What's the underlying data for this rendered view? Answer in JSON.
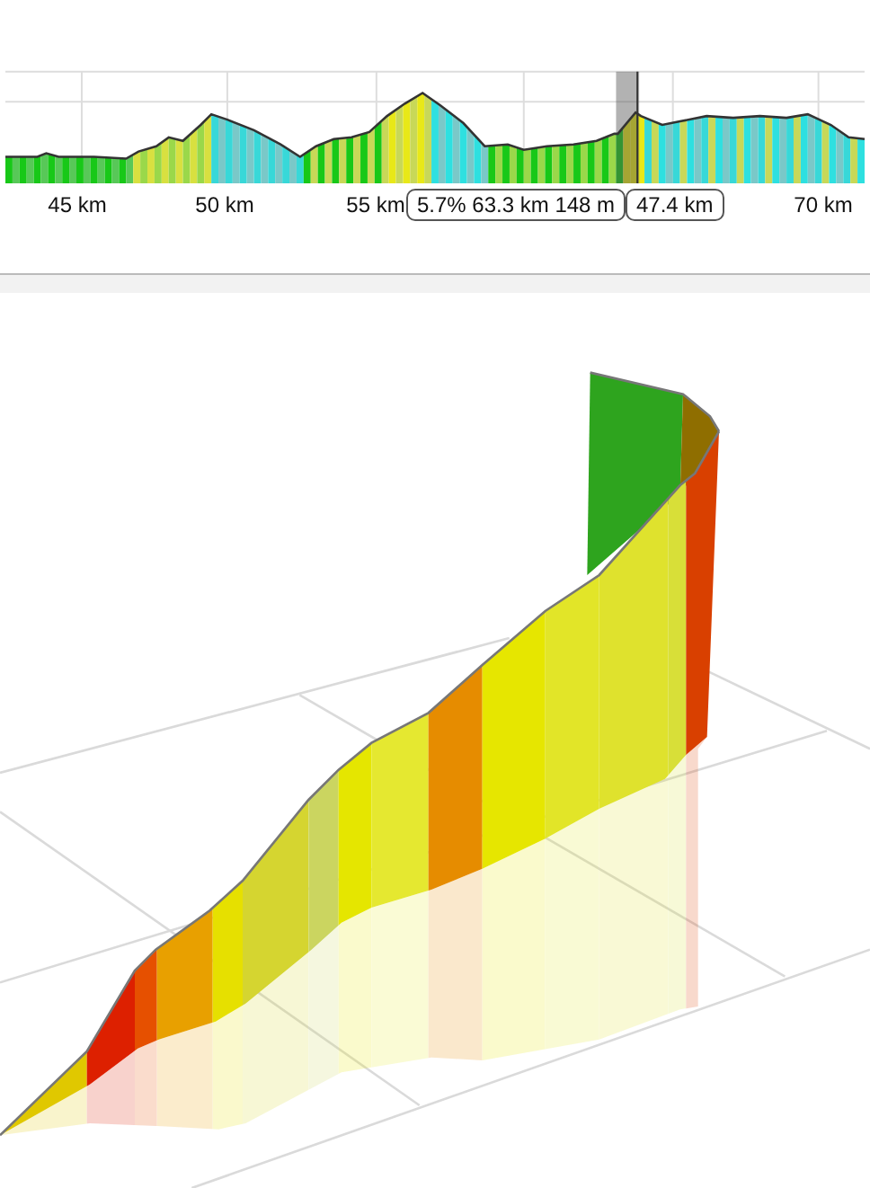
{
  "elevation_profile": {
    "x_labels": [
      {
        "text": "45 km"
      },
      {
        "text": "50 km"
      },
      {
        "text": "55 km"
      },
      {
        "text": "70 km"
      }
    ],
    "tooltips": [
      {
        "text": "5.7% 63.3 km 148 m"
      },
      {
        "text": "47.4 km"
      }
    ]
  }
}
